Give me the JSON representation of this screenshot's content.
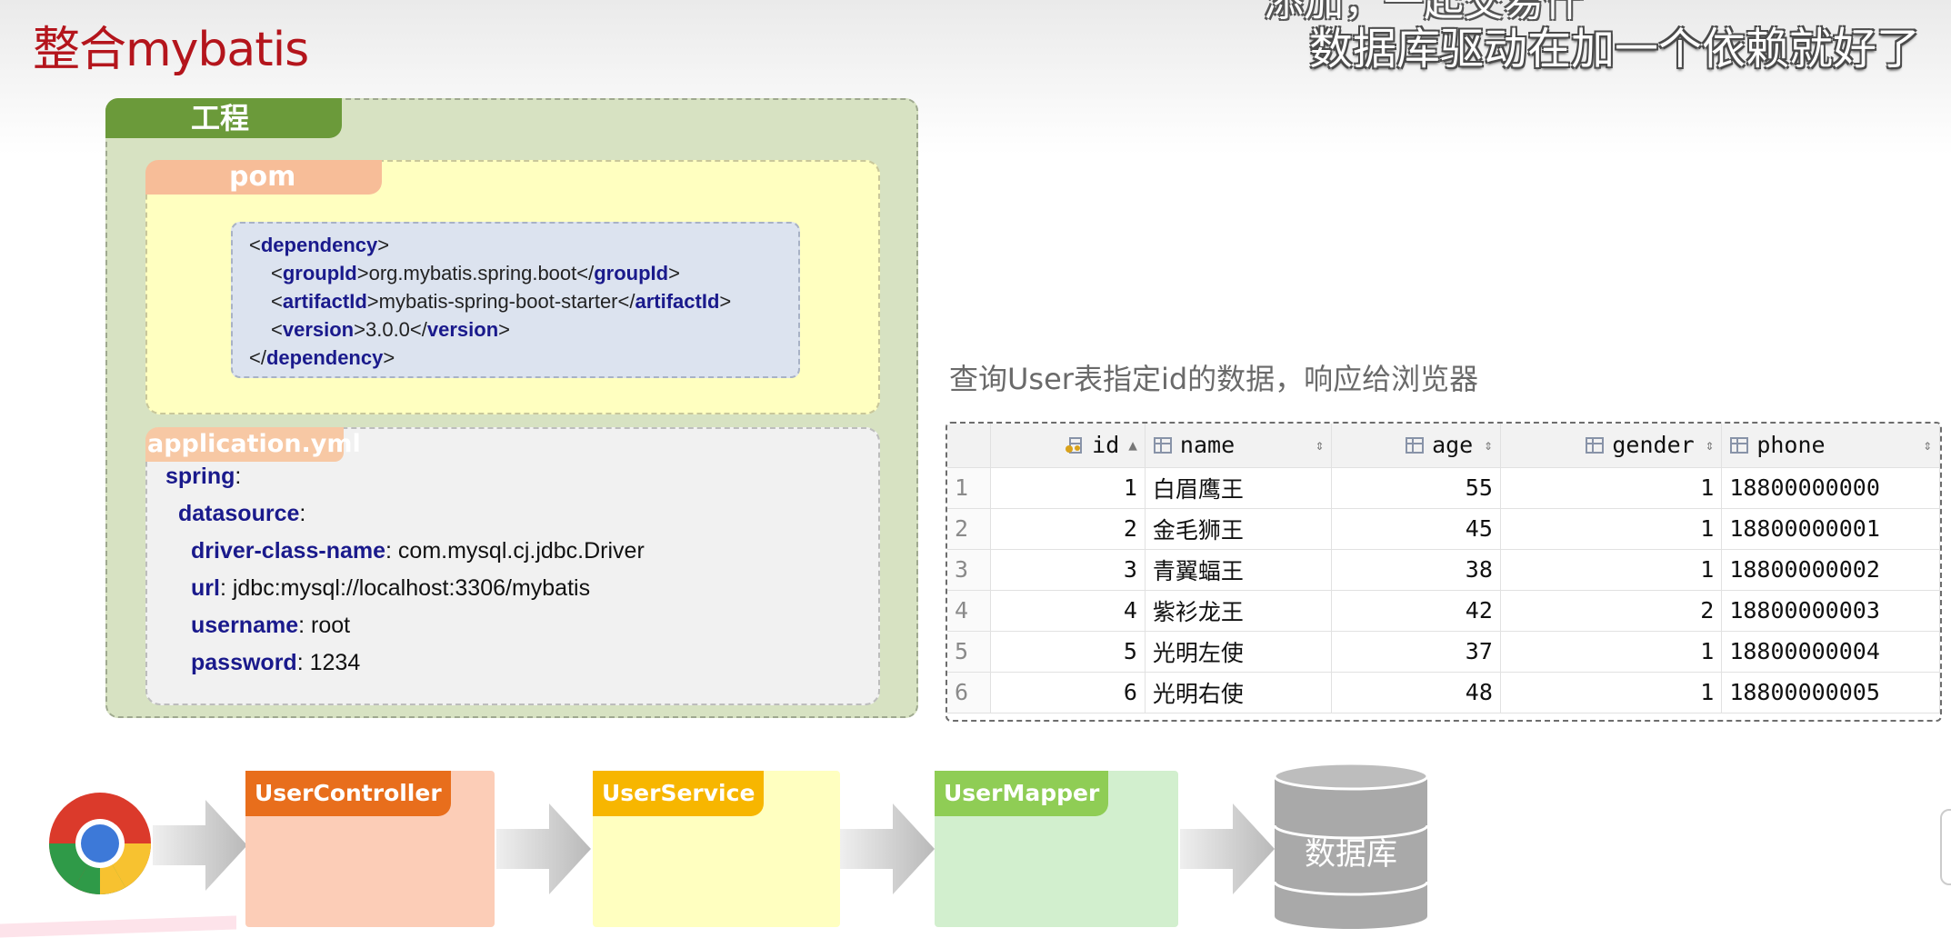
{
  "slide": {
    "title": "整合mybatis",
    "subtitle_cut": "添加，一起交易什",
    "subtitle": "数据库驱动在加一个依赖就好了",
    "caption": "查询User表指定id的数据，响应给浏览器"
  },
  "project": {
    "label": "工程",
    "pom": {
      "label": "pom",
      "code": {
        "lt": "<",
        "gt": ">",
        "lt_close": "</",
        "dependency": "dependency",
        "groupId": "groupId",
        "groupId_value": "org.mybatis.spring.boot",
        "artifactId": "artifactId",
        "artifactId_value": "mybatis-spring-boot-starter",
        "version": "version",
        "version_value": "3.0.0"
      }
    },
    "yml": {
      "label": "application.yml",
      "lines": [
        {
          "key": "spring",
          "sep": ":",
          "value": ""
        },
        {
          "key": "datasource",
          "sep": ":",
          "value": ""
        },
        {
          "key": "driver-class-name",
          "sep": ":",
          "value": " com.mysql.cj.jdbc.Driver"
        },
        {
          "key": "url",
          "sep": ":",
          "value": " jdbc:mysql://localhost:3306/mybatis"
        },
        {
          "key": "username",
          "sep": ":",
          "value": " root"
        },
        {
          "key": "password",
          "sep": ":",
          "value": " 1234"
        }
      ]
    }
  },
  "table": {
    "columns": [
      "id",
      "name",
      "age",
      "gender",
      "phone"
    ],
    "sort_asc": "▲",
    "sort_both": "⇕",
    "rows": [
      {
        "rn": "1",
        "id": "1",
        "name": "白眉鹰王",
        "age": "55",
        "gender": "1",
        "phone": "18800000000"
      },
      {
        "rn": "2",
        "id": "2",
        "name": "金毛狮王",
        "age": "45",
        "gender": "1",
        "phone": "18800000001"
      },
      {
        "rn": "3",
        "id": "3",
        "name": "青翼蝠王",
        "age": "38",
        "gender": "1",
        "phone": "18800000002"
      },
      {
        "rn": "4",
        "id": "4",
        "name": "紫衫龙王",
        "age": "42",
        "gender": "2",
        "phone": "18800000003"
      },
      {
        "rn": "5",
        "id": "5",
        "name": "光明左使",
        "age": "37",
        "gender": "1",
        "phone": "18800000004"
      },
      {
        "rn": "6",
        "id": "6",
        "name": "光明右使",
        "age": "48",
        "gender": "1",
        "phone": "18800000005"
      }
    ]
  },
  "flow": {
    "controller": "UserController",
    "service": "UserService",
    "mapper": "UserMapper",
    "database": "数据库"
  },
  "colors": {
    "title": "#b4151c",
    "project_tag": "#6b9a3a",
    "controller": "#e86e1c",
    "service": "#f7b600",
    "mapper": "#8fcd55"
  }
}
